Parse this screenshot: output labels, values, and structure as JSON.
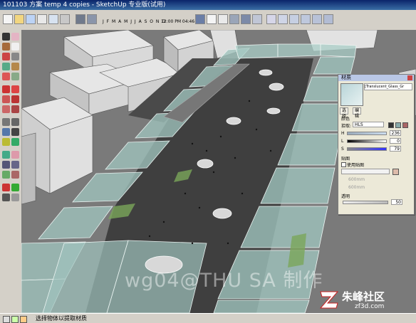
{
  "window": {
    "title": "101103 方案 temp 4 copies - SketchUp 专业版(试用)"
  },
  "toolbar": {
    "months": "J F M A M J J A S O N D",
    "times": "12:00 PM  04:46 PM"
  },
  "panel": {
    "title": "材质",
    "material_name": "[Translucent_Glass_Gr",
    "tabs": [
      "选择",
      "编辑"
    ],
    "color_label": "颜色",
    "picker_label": "拾取:",
    "picker_value": "HLS",
    "channels": [
      {
        "label": "H",
        "value": "236"
      },
      {
        "label": "L",
        "value": "0"
      },
      {
        "label": "S",
        "value": "79"
      }
    ],
    "texture_label": "贴图",
    "use_texture_label": "使用贴图",
    "tex_w": "600mm",
    "tex_h": "600mm",
    "opacity_label": "透明",
    "opacity_value": "50"
  },
  "status": {
    "text": "选择物体以提取材质"
  },
  "watermark": {
    "text": "wg04@THU SA 制作"
  },
  "logo": {
    "big": "朱峰社区",
    "small": "zf3d.com"
  },
  "colors": {
    "glass": "#9fc3bd",
    "floor": "#3f3f3f",
    "title_bar": "#0a246a",
    "toolbar_bg": "#d4d0c8"
  }
}
